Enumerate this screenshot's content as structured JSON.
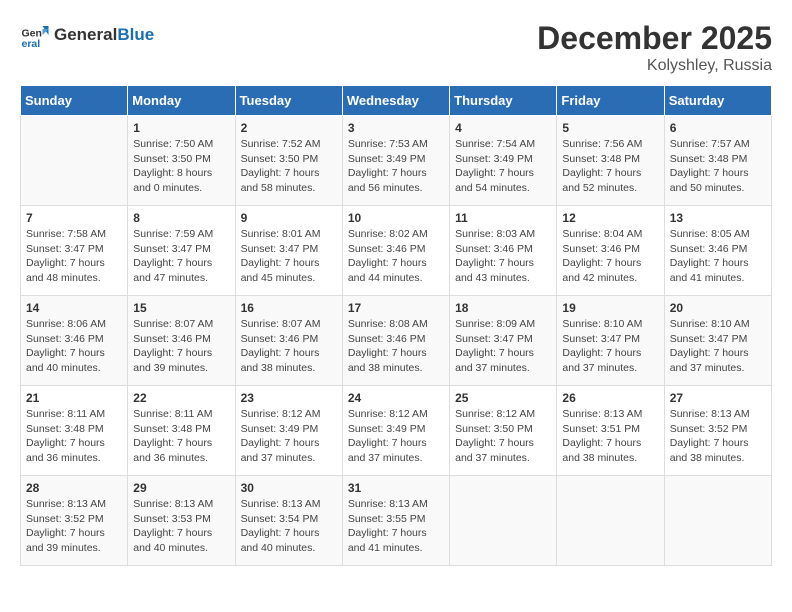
{
  "logo": {
    "general": "General",
    "blue": "Blue"
  },
  "title": "December 2025",
  "subtitle": "Kolyshley, Russia",
  "days_of_week": [
    "Sunday",
    "Monday",
    "Tuesday",
    "Wednesday",
    "Thursday",
    "Friday",
    "Saturday"
  ],
  "weeks": [
    [
      {
        "day": "",
        "content": ""
      },
      {
        "day": "1",
        "content": "Sunrise: 7:50 AM\nSunset: 3:50 PM\nDaylight: 8 hours\nand 0 minutes."
      },
      {
        "day": "2",
        "content": "Sunrise: 7:52 AM\nSunset: 3:50 PM\nDaylight: 7 hours\nand 58 minutes."
      },
      {
        "day": "3",
        "content": "Sunrise: 7:53 AM\nSunset: 3:49 PM\nDaylight: 7 hours\nand 56 minutes."
      },
      {
        "day": "4",
        "content": "Sunrise: 7:54 AM\nSunset: 3:49 PM\nDaylight: 7 hours\nand 54 minutes."
      },
      {
        "day": "5",
        "content": "Sunrise: 7:56 AM\nSunset: 3:48 PM\nDaylight: 7 hours\nand 52 minutes."
      },
      {
        "day": "6",
        "content": "Sunrise: 7:57 AM\nSunset: 3:48 PM\nDaylight: 7 hours\nand 50 minutes."
      }
    ],
    [
      {
        "day": "7",
        "content": "Sunrise: 7:58 AM\nSunset: 3:47 PM\nDaylight: 7 hours\nand 48 minutes."
      },
      {
        "day": "8",
        "content": "Sunrise: 7:59 AM\nSunset: 3:47 PM\nDaylight: 7 hours\nand 47 minutes."
      },
      {
        "day": "9",
        "content": "Sunrise: 8:01 AM\nSunset: 3:47 PM\nDaylight: 7 hours\nand 45 minutes."
      },
      {
        "day": "10",
        "content": "Sunrise: 8:02 AM\nSunset: 3:46 PM\nDaylight: 7 hours\nand 44 minutes."
      },
      {
        "day": "11",
        "content": "Sunrise: 8:03 AM\nSunset: 3:46 PM\nDaylight: 7 hours\nand 43 minutes."
      },
      {
        "day": "12",
        "content": "Sunrise: 8:04 AM\nSunset: 3:46 PM\nDaylight: 7 hours\nand 42 minutes."
      },
      {
        "day": "13",
        "content": "Sunrise: 8:05 AM\nSunset: 3:46 PM\nDaylight: 7 hours\nand 41 minutes."
      }
    ],
    [
      {
        "day": "14",
        "content": "Sunrise: 8:06 AM\nSunset: 3:46 PM\nDaylight: 7 hours\nand 40 minutes."
      },
      {
        "day": "15",
        "content": "Sunrise: 8:07 AM\nSunset: 3:46 PM\nDaylight: 7 hours\nand 39 minutes."
      },
      {
        "day": "16",
        "content": "Sunrise: 8:07 AM\nSunset: 3:46 PM\nDaylight: 7 hours\nand 38 minutes."
      },
      {
        "day": "17",
        "content": "Sunrise: 8:08 AM\nSunset: 3:46 PM\nDaylight: 7 hours\nand 38 minutes."
      },
      {
        "day": "18",
        "content": "Sunrise: 8:09 AM\nSunset: 3:47 PM\nDaylight: 7 hours\nand 37 minutes."
      },
      {
        "day": "19",
        "content": "Sunrise: 8:10 AM\nSunset: 3:47 PM\nDaylight: 7 hours\nand 37 minutes."
      },
      {
        "day": "20",
        "content": "Sunrise: 8:10 AM\nSunset: 3:47 PM\nDaylight: 7 hours\nand 37 minutes."
      }
    ],
    [
      {
        "day": "21",
        "content": "Sunrise: 8:11 AM\nSunset: 3:48 PM\nDaylight: 7 hours\nand 36 minutes."
      },
      {
        "day": "22",
        "content": "Sunrise: 8:11 AM\nSunset: 3:48 PM\nDaylight: 7 hours\nand 36 minutes."
      },
      {
        "day": "23",
        "content": "Sunrise: 8:12 AM\nSunset: 3:49 PM\nDaylight: 7 hours\nand 37 minutes."
      },
      {
        "day": "24",
        "content": "Sunrise: 8:12 AM\nSunset: 3:49 PM\nDaylight: 7 hours\nand 37 minutes."
      },
      {
        "day": "25",
        "content": "Sunrise: 8:12 AM\nSunset: 3:50 PM\nDaylight: 7 hours\nand 37 minutes."
      },
      {
        "day": "26",
        "content": "Sunrise: 8:13 AM\nSunset: 3:51 PM\nDaylight: 7 hours\nand 38 minutes."
      },
      {
        "day": "27",
        "content": "Sunrise: 8:13 AM\nSunset: 3:52 PM\nDaylight: 7 hours\nand 38 minutes."
      }
    ],
    [
      {
        "day": "28",
        "content": "Sunrise: 8:13 AM\nSunset: 3:52 PM\nDaylight: 7 hours\nand 39 minutes."
      },
      {
        "day": "29",
        "content": "Sunrise: 8:13 AM\nSunset: 3:53 PM\nDaylight: 7 hours\nand 40 minutes."
      },
      {
        "day": "30",
        "content": "Sunrise: 8:13 AM\nSunset: 3:54 PM\nDaylight: 7 hours\nand 40 minutes."
      },
      {
        "day": "31",
        "content": "Sunrise: 8:13 AM\nSunset: 3:55 PM\nDaylight: 7 hours\nand 41 minutes."
      },
      {
        "day": "",
        "content": ""
      },
      {
        "day": "",
        "content": ""
      },
      {
        "day": "",
        "content": ""
      }
    ]
  ]
}
